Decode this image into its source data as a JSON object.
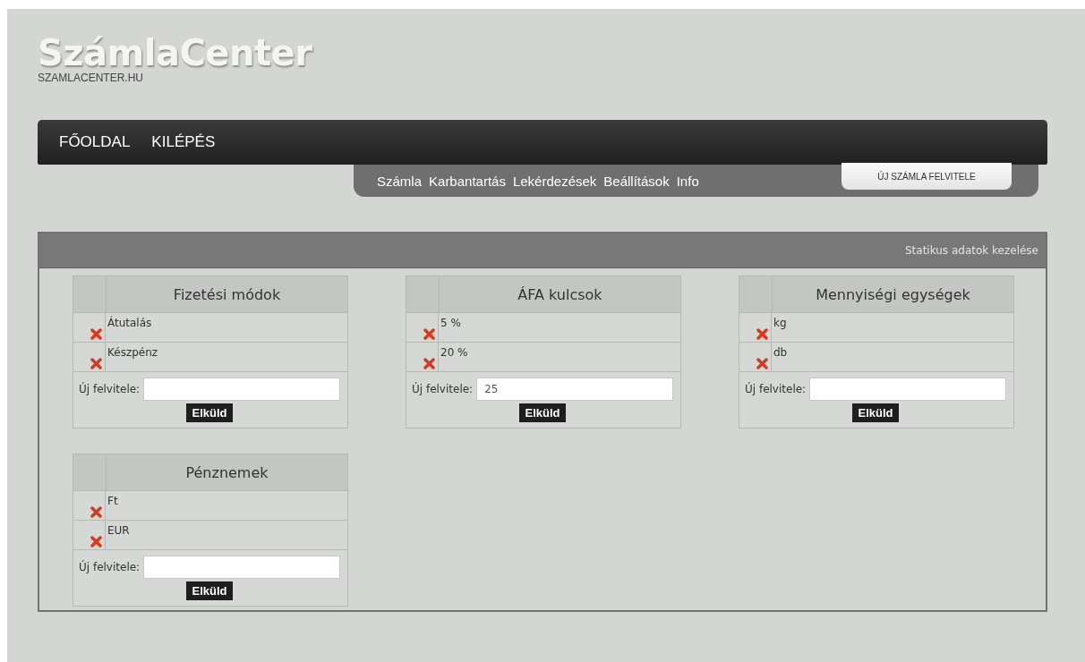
{
  "logo": {
    "title": "SzámlaCenter",
    "subtitle": "SZAMLACENTER.HU"
  },
  "main_nav": [
    {
      "label": "FŐOLDAL"
    },
    {
      "label": "KILÉPÉS"
    }
  ],
  "sub_nav": [
    {
      "label": "Számla"
    },
    {
      "label": "Karbantartás"
    },
    {
      "label": "Lekérdezések"
    },
    {
      "label": "Beállítások"
    },
    {
      "label": "Info"
    }
  ],
  "new_invoice_button": "ÚJ SZÁMLA FELVITELE",
  "panel": {
    "title": "Statikus adatok kezelése",
    "tables": [
      {
        "title": "Fizetési módok",
        "items": [
          "Átutalás",
          "Készpénz"
        ],
        "new_label": "Új felvitele:",
        "button": "Elküld"
      },
      {
        "title": "ÁFA kulcsok",
        "items": [
          "5 %",
          "20 %"
        ],
        "new_label": "Új felvitele:",
        "value": "25",
        "button": "Elküld"
      },
      {
        "title": "Mennyiségi egységek",
        "items": [
          "kg",
          "db"
        ],
        "new_label": "Új felvitele:",
        "button": "Elküld"
      },
      {
        "title": "Pénznemek",
        "items": [
          "Ft",
          "EUR"
        ],
        "new_label": "Új felvitele:",
        "button": "Elküld"
      }
    ]
  }
}
